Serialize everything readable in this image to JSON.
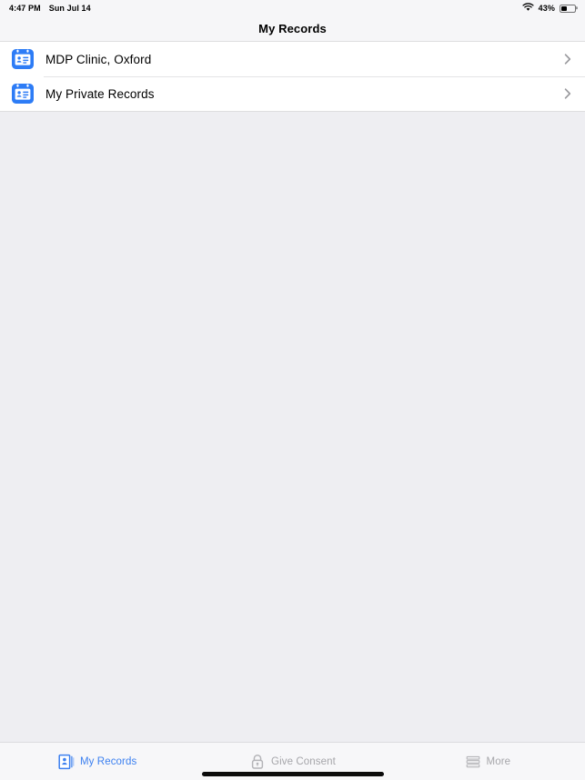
{
  "status_bar": {
    "time": "4:47 PM",
    "date": "Sun Jul 14",
    "wifi_icon": "wifi-icon",
    "battery_percent": "43%",
    "battery_level": 43,
    "battery_icon": "battery-icon"
  },
  "header": {
    "title": "My Records"
  },
  "list": {
    "rows": [
      {
        "label": "MDP Clinic, Oxford",
        "icon": "id-card-icon",
        "accessory": "chevron-right-icon"
      },
      {
        "label": "My Private Records",
        "icon": "id-card-icon",
        "accessory": "chevron-right-icon"
      }
    ]
  },
  "tab_bar": {
    "tabs": [
      {
        "label": "My Records",
        "icon": "records-card-icon",
        "active": true
      },
      {
        "label": "Give Consent",
        "icon": "lock-icon",
        "active": false
      },
      {
        "label": "More",
        "icon": "stack-lines-icon",
        "active": false
      }
    ]
  },
  "colors": {
    "accent_blue": "#3c80f0",
    "icon_blue": "#2d7cf6",
    "inactive_gray": "#a6a6aa",
    "page_background": "#eeeef2",
    "bar_background": "#f6f6f8",
    "row_background": "#ffffff",
    "separator": "#dededf"
  }
}
